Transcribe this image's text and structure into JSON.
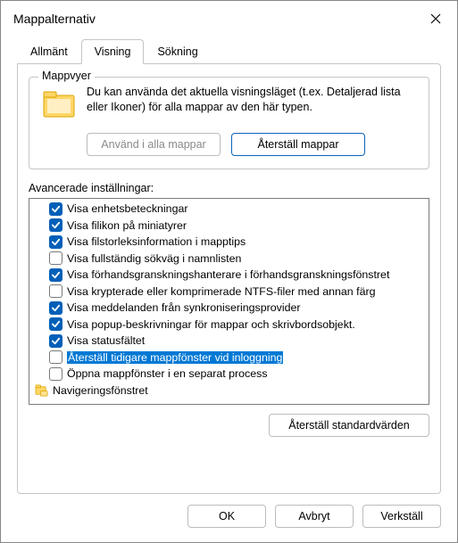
{
  "title": "Mappalternativ",
  "tabs": {
    "general": "Allmänt",
    "view": "Visning",
    "search": "Sökning"
  },
  "folderviews": {
    "legend": "Mappvyer",
    "desc": "Du kan använda det aktuella visningsläget (t.ex. Detaljerad lista eller Ikoner) för alla mappar av den här typen.",
    "apply_btn": "Använd i alla mappar",
    "reset_btn": "Återställ mappar"
  },
  "advanced": {
    "label": "Avancerade inställningar:",
    "items": [
      {
        "label": "Visa enhetsbeteckningar",
        "checked": true
      },
      {
        "label": "Visa filikon på miniatyrer",
        "checked": true
      },
      {
        "label": "Visa filstorleksinformation i mapptips",
        "checked": true
      },
      {
        "label": "Visa fullständig sökväg i namnlisten",
        "checked": false
      },
      {
        "label": "Visa förhandsgranskningshanterare i förhandsgranskningsfönstret",
        "checked": true
      },
      {
        "label": "Visa krypterade eller komprimerade NTFS-filer med annan färg",
        "checked": false
      },
      {
        "label": "Visa meddelanden från synkroniseringsprovider",
        "checked": true
      },
      {
        "label": "Visa popup-beskrivningar för mappar och skrivbordsobjekt.",
        "checked": true
      },
      {
        "label": "Visa statusfältet",
        "checked": true
      },
      {
        "label": "Återställ tidigare mappfönster vid inloggning",
        "checked": false,
        "selected": true
      },
      {
        "label": "Öppna mappfönster i en separat process",
        "checked": false
      }
    ],
    "nav_pane": "Navigeringsfönstret"
  },
  "reset_defaults": "Återställ standardvärden",
  "footer": {
    "ok": "OK",
    "cancel": "Avbryt",
    "apply": "Verkställ"
  }
}
